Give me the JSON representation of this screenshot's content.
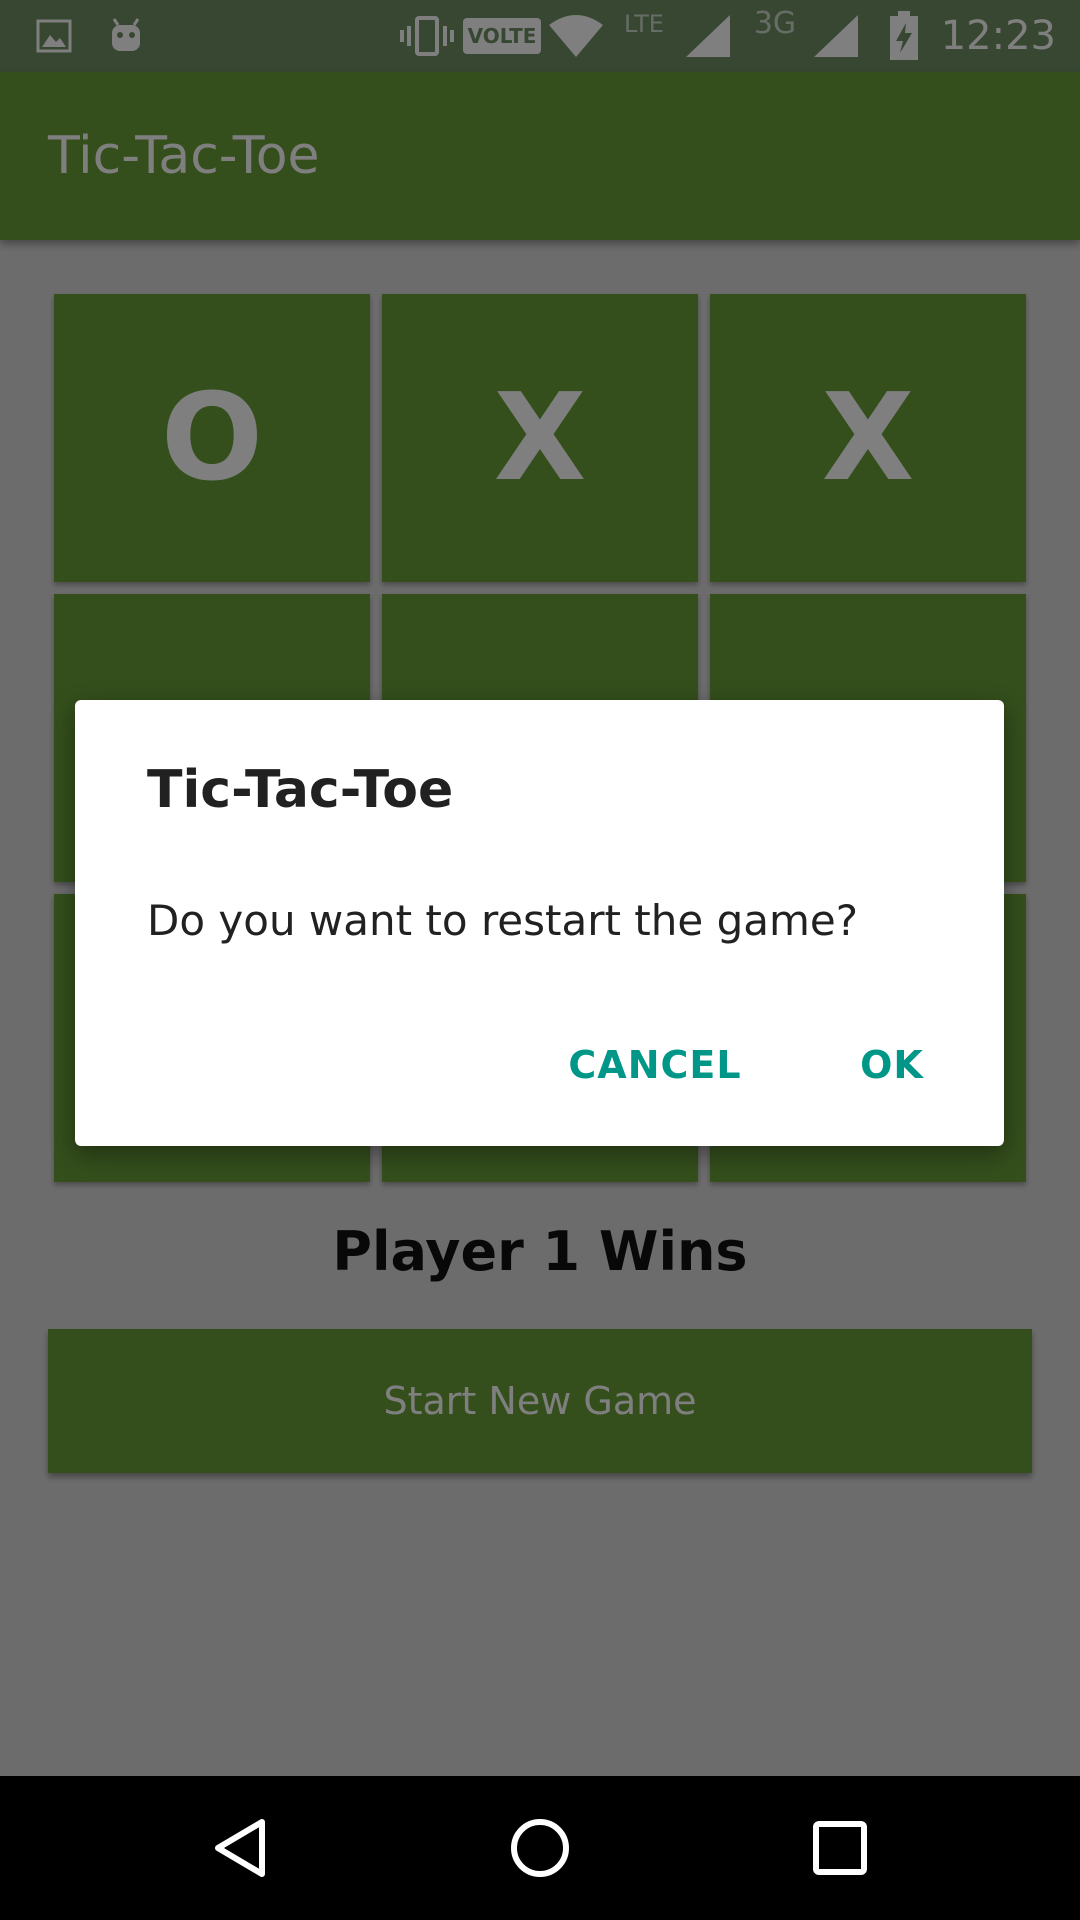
{
  "status_bar": {
    "time": "12:23",
    "volte_label": "VOLTE",
    "lte_label": "LTE",
    "network_label": "3G",
    "icons": [
      "image-icon",
      "android-icon",
      "vibrate-icon",
      "volte-icon",
      "wifi-icon",
      "signal-icon",
      "signal-icon",
      "battery-charging-icon"
    ]
  },
  "app_bar": {
    "title": "Tic-Tac-Toe"
  },
  "board": {
    "cells": [
      "O",
      "X",
      "X",
      "",
      "",
      "",
      "",
      "",
      ""
    ]
  },
  "result": {
    "text": "Player 1 Wins"
  },
  "new_game_button": {
    "label": "Start New Game"
  },
  "dialog": {
    "title": "Tic-Tac-Toe",
    "message": "Do you want to restart the game?",
    "cancel_label": "CANCEL",
    "ok_label": "OK"
  },
  "colors": {
    "primary": "#689f38",
    "status_bar": "#6e8f63",
    "accent": "#009688",
    "background": "#d9d9d9"
  },
  "nav_bar": {
    "icons": [
      "back-icon",
      "home-icon",
      "recents-icon"
    ]
  }
}
